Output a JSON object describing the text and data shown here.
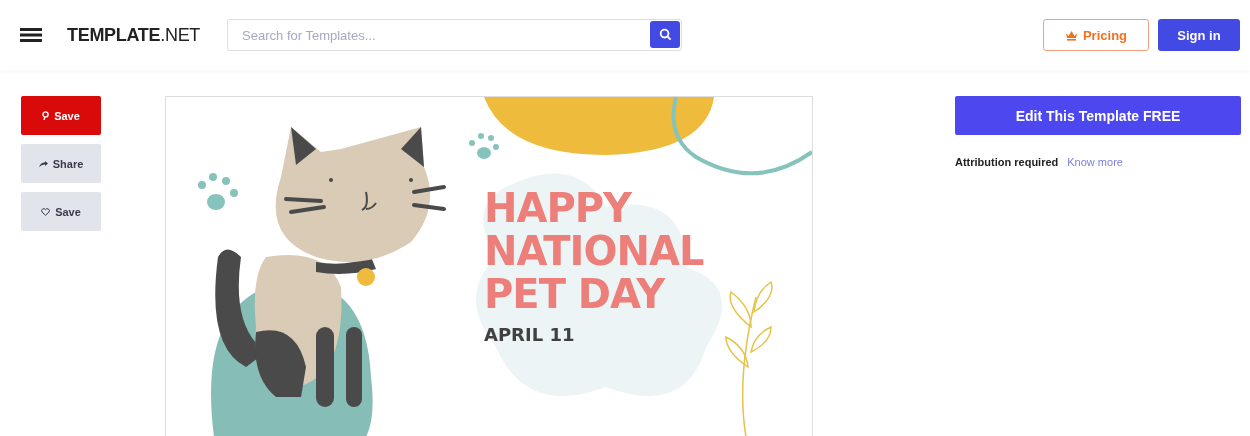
{
  "header": {
    "logo": "**TEMPLATE**.NET",
    "search": {
      "placeholder": "Search for Templates..."
    },
    "buttons": [
      {
        "kind": "outline",
        "label": "Pricing"
      },
      {
        "kind": "solid",
        "label": "Sign in"
      }
    ]
  },
  "side_actions": [
    {
      "kind": "pin",
      "label": "Save"
    },
    {
      "kind": "share",
      "label": "Share"
    },
    {
      "kind": "heart",
      "label": "Save"
    }
  ],
  "preview": {
    "title_lines": [
      "HAPPY",
      "NATIONAL",
      "PET DAY"
    ],
    "date": "APRIL 11"
  },
  "panel": {
    "edit_button": "Edit This Template FREE",
    "attribution": "Attribution required",
    "link": "Know more"
  }
}
